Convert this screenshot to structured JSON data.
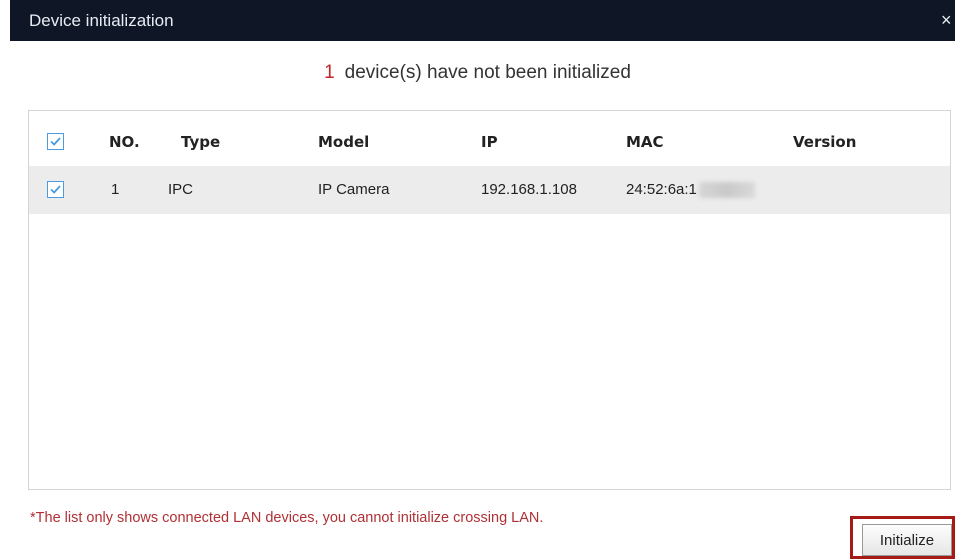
{
  "window": {
    "title": "Device initialization",
    "close_glyph": "×"
  },
  "summary": {
    "count": "1",
    "text": "device(s) have not been initialized"
  },
  "table": {
    "columns": [
      "NO.",
      "Type",
      "Model",
      "IP",
      "MAC",
      "Version"
    ],
    "header_checked": true,
    "rows": [
      {
        "checked": true,
        "no": "1",
        "type": "IPC",
        "model": "IP Camera",
        "ip": "192.168.1.108",
        "mac": "24:52:6a:1",
        "mac_redacted": true,
        "version": ""
      }
    ]
  },
  "footer": {
    "note": "*The list only shows connected LAN devices, you cannot initialize crossing LAN.",
    "initialize_label": "Initialize"
  },
  "colors": {
    "titlebar_bg": "#0f1726",
    "count_red": "#c0262c",
    "note_red": "#b03035",
    "highlight_border": "#a51a14",
    "checkbox_blue": "#4a9be0",
    "selected_row_bg": "#ececec"
  },
  "icons": {
    "checkbox": "checkmark-icon",
    "close": "close-icon"
  }
}
